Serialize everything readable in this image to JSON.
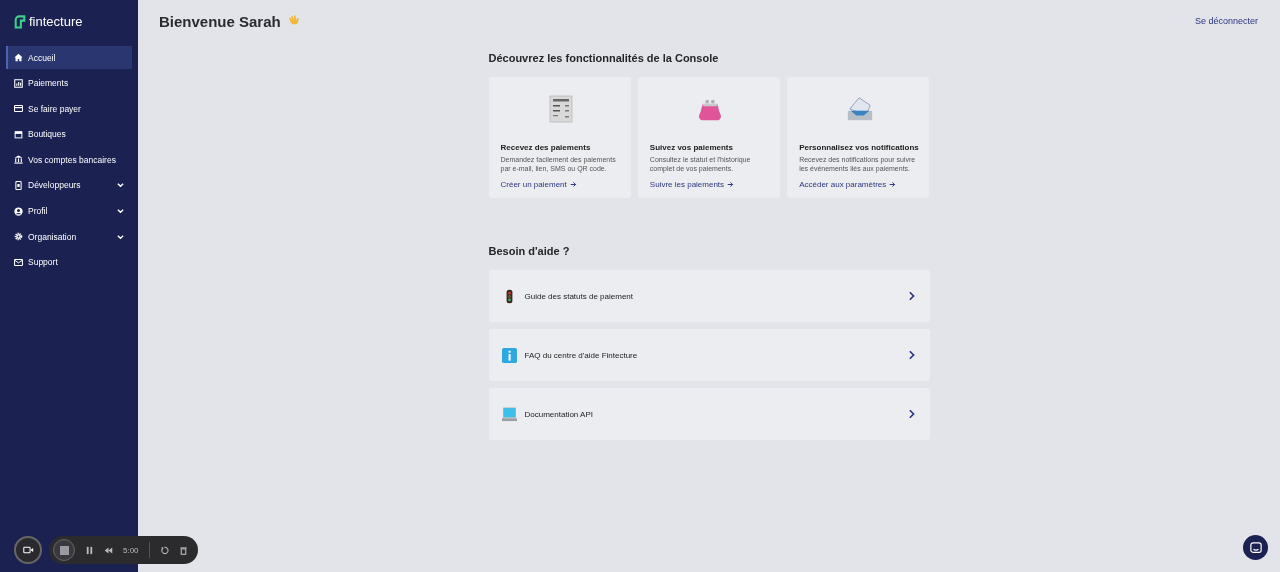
{
  "sidebar": {
    "logo": "fintecture",
    "items": [
      {
        "label": "Accueil",
        "selected": true,
        "expandable": false
      },
      {
        "label": "Paiements",
        "selected": false,
        "expandable": false
      },
      {
        "label": "Se faire payer",
        "selected": false,
        "expandable": false
      },
      {
        "label": "Boutiques",
        "selected": false,
        "expandable": false
      },
      {
        "label": "Vos comptes bancaires",
        "selected": false,
        "expandable": false
      },
      {
        "label": "Développeurs",
        "selected": false,
        "expandable": true
      },
      {
        "label": "Profil",
        "selected": false,
        "expandable": true
      },
      {
        "label": "Organisation",
        "selected": false,
        "expandable": true
      },
      {
        "label": "Support",
        "selected": false,
        "expandable": false
      }
    ]
  },
  "header": {
    "greeting": "Bienvenue Sarah",
    "logout": "Se déconnecter"
  },
  "features": {
    "title": "Découvrez les fonctionnalités de la Console",
    "cards": [
      {
        "title": "Recevez des paiements",
        "text": "Demandez facilement des paiements par e-mail, lien, SMS ou QR code.",
        "link": "Créer un paiement"
      },
      {
        "title": "Suivez vos paiements",
        "text": "Consultez le statut et l'historique complet de vos paiements.",
        "link": "Suivre les paiements"
      },
      {
        "title": "Personnalisez vos notifications",
        "text": "Recevez des notifications pour suivre les événements liés aux paiements.",
        "link": "Accéder aux paramètres"
      }
    ]
  },
  "help": {
    "title": "Besoin d'aide ?",
    "items": [
      {
        "label": "Guide des statuts de paiement"
      },
      {
        "label": "FAQ du centre d'aide Fintecture"
      },
      {
        "label": "Documentation API"
      }
    ]
  },
  "recorder": {
    "time": "5:00"
  }
}
